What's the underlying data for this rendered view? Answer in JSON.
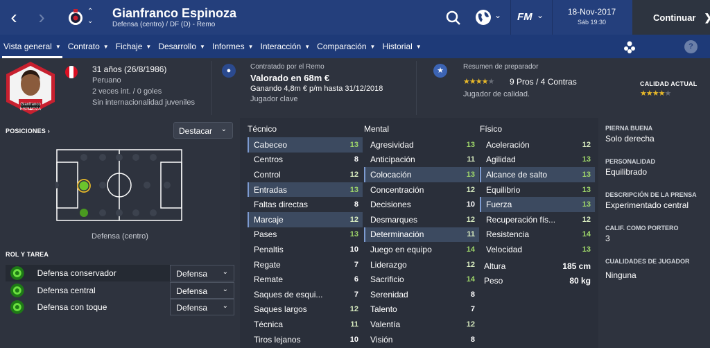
{
  "header": {
    "player_name": "Gianfranco Espinoza",
    "player_subtitle": "Defensa (centro) / DF (D) - Remo",
    "date": "18-Nov-2017",
    "time": "Sáb 19:30",
    "continue_label": "Continuar",
    "fm_label": "FM",
    "accent_color": "#243f7c"
  },
  "menu": {
    "items": [
      {
        "label": "Vista general"
      },
      {
        "label": "Contrato"
      },
      {
        "label": "Fichaje"
      },
      {
        "label": "Desarrollo"
      },
      {
        "label": "Informes"
      },
      {
        "label": "Interacción"
      },
      {
        "label": "Comparación"
      },
      {
        "label": "Historial"
      }
    ],
    "help": "?"
  },
  "info": {
    "age": "31 años (26/8/1986)",
    "nationality": "Peruano",
    "caps": "2 veces int. / 0 goles",
    "youth": "Sin internacionalidad juveniles",
    "portrait_caption": "Gianfranco ESPINOZA",
    "contract_heading": "Contratado por el Remo",
    "value": "Valorado en 68m €",
    "wage": "Ganando 4,8m € p/m hasta 31/12/2018",
    "role_status": "Jugador clave",
    "coach_heading": "Resumen de preparador",
    "coach_rating": 3.5,
    "pros_cons": "9 Pros / 4 Contras",
    "coach_summary": "Jugador de calidad.",
    "quality_label": "CALIDAD ACTUAL",
    "quality_rating": 3.5
  },
  "positions": {
    "heading": "POSICIONES",
    "highlight_dropdown": "Destacar",
    "position_label": "Defensa (centro)"
  },
  "roles": {
    "heading": "ROL Y TAREA",
    "items": [
      {
        "name": "Defensa conservador",
        "duty": "Defensa"
      },
      {
        "name": "Defensa central",
        "duty": "Defensa"
      },
      {
        "name": "Defensa con toque",
        "duty": "Defensa"
      }
    ]
  },
  "attributes": {
    "technical": {
      "title": "Técnico",
      "rows": [
        {
          "name": "Cabeceo",
          "value": "13"
        },
        {
          "name": "Centros",
          "value": "8"
        },
        {
          "name": "Control",
          "value": "12"
        },
        {
          "name": "Entradas",
          "value": "13"
        },
        {
          "name": "Faltas directas",
          "value": "8"
        },
        {
          "name": "Marcaje",
          "value": "12"
        },
        {
          "name": "Pases",
          "value": "13"
        },
        {
          "name": "Penaltis",
          "value": "10"
        },
        {
          "name": "Regate",
          "value": "7"
        },
        {
          "name": "Remate",
          "value": "6"
        },
        {
          "name": "Saques de esqui...",
          "value": "7"
        },
        {
          "name": "Saques largos",
          "value": "12"
        },
        {
          "name": "Técnica",
          "value": "11"
        },
        {
          "name": "Tiros lejanos",
          "value": "10"
        }
      ]
    },
    "mental": {
      "title": "Mental",
      "rows": [
        {
          "name": "Agresividad",
          "value": "13"
        },
        {
          "name": "Anticipación",
          "value": "11"
        },
        {
          "name": "Colocación",
          "value": "13"
        },
        {
          "name": "Concentración",
          "value": "12"
        },
        {
          "name": "Decisiones",
          "value": "10"
        },
        {
          "name": "Desmarques",
          "value": "12"
        },
        {
          "name": "Determinación",
          "value": "11"
        },
        {
          "name": "Juego en equipo",
          "value": "14"
        },
        {
          "name": "Liderazgo",
          "value": "12"
        },
        {
          "name": "Sacrificio",
          "value": "14"
        },
        {
          "name": "Serenidad",
          "value": "8"
        },
        {
          "name": "Talento",
          "value": "7"
        },
        {
          "name": "Valentía",
          "value": "12"
        },
        {
          "name": "Visión",
          "value": "8"
        }
      ]
    },
    "physical": {
      "title": "Físico",
      "rows": [
        {
          "name": "Aceleración",
          "value": "12"
        },
        {
          "name": "Agilidad",
          "value": "13"
        },
        {
          "name": "Alcance de salto",
          "value": "13"
        },
        {
          "name": "Equilibrio",
          "value": "13"
        },
        {
          "name": "Fuerza",
          "value": "13"
        },
        {
          "name": "Recuperación fís...",
          "value": "12"
        },
        {
          "name": "Resistencia",
          "value": "14"
        },
        {
          "name": "Velocidad",
          "value": "13"
        }
      ],
      "height_label": "Altura",
      "height_value": "185 cm",
      "weight_label": "Peso",
      "weight_value": "80 kg"
    }
  },
  "details": {
    "foot_heading": "PIERNA BUENA",
    "foot_value": "Solo derecha",
    "personality_heading": "PERSONALIDAD",
    "personality_value": "Equilibrado",
    "press_heading": "DESCRIPCIÓN DE LA PRENSA",
    "press_value": "Experimentado central",
    "gk_heading": "CALIF. COMO PORTERO",
    "gk_value": "3",
    "qualities_heading": "CUALIDADES DE JUGADOR",
    "qualities_value": "Ninguna"
  }
}
